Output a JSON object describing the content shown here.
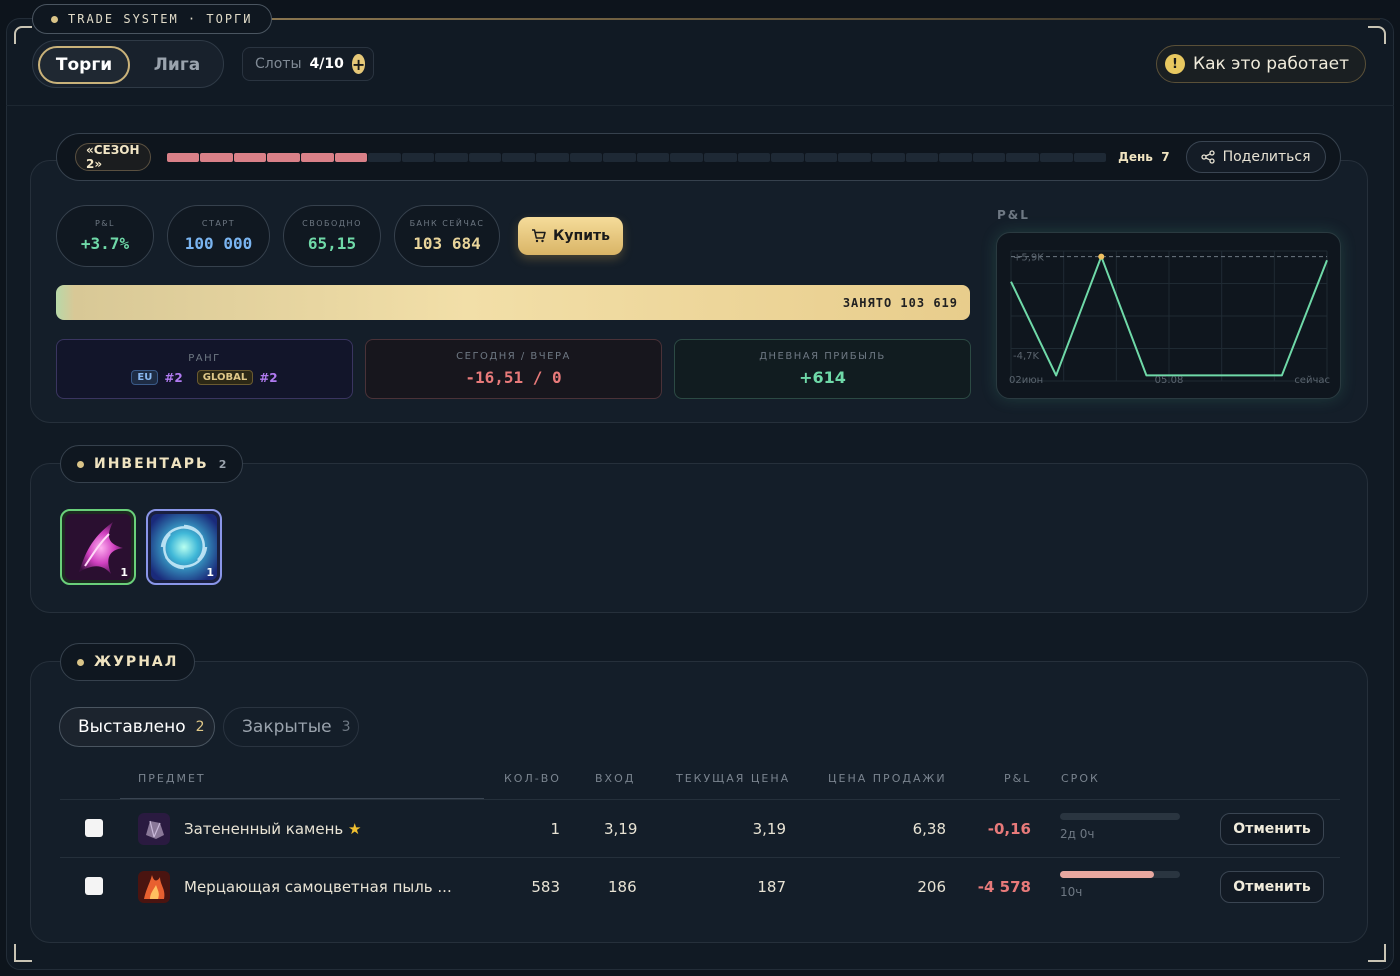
{
  "app": {
    "title": "TRADE SYSTEM · ТОРГИ"
  },
  "header": {
    "tabs": [
      "Торги",
      "Лига"
    ],
    "slots_label": "Слоты",
    "slots_value": "4/10",
    "how_label": "Как это работает"
  },
  "season": {
    "label": "«СЕЗОН 2»",
    "progress": {
      "filled": 6,
      "total": 28
    },
    "day_label": "День",
    "day_value": "7",
    "share_label": "Поделиться"
  },
  "stats": {
    "pnl": {
      "label": "P&L",
      "value": "+3.7%"
    },
    "start": {
      "label": "СТАРТ",
      "value": "100 000"
    },
    "free": {
      "label": "СВОБОДНО",
      "value": "65,15"
    },
    "bank": {
      "label": "БАНК СЕЙЧАС",
      "value": "103 684"
    },
    "buy_label": "Купить",
    "busy_label": "ЗАНЯТО",
    "busy_value": "103 619"
  },
  "cards": {
    "rank": {
      "label": "РАНГ",
      "eu_tag": "EU",
      "eu_rank": "#2",
      "global_tag": "GLOBAL",
      "global_rank": "#2"
    },
    "today": {
      "label": "СЕГОДНЯ / ВЧЕРА",
      "value": "-16,51 / 0"
    },
    "daily": {
      "label": "ДНЕВНАЯ ПРИБЫЛЬ",
      "value": "+614"
    }
  },
  "chart_data": {
    "type": "line",
    "title": "P&L",
    "y_tick_labels": [
      "+5,9K",
      "-4,7K"
    ],
    "x_tick_labels": [
      "02июн",
      "05.08",
      "сейчас"
    ],
    "values": [
      3.2,
      -6.9,
      5.9,
      -6.9,
      -6.9,
      -6.9,
      -6.9,
      5.5
    ],
    "ylim": [
      -7.5,
      6.5
    ],
    "reference_line": 5.9,
    "highlight_index": 2,
    "color": "#6fd9a8"
  },
  "inventory": {
    "title": "ИНВЕНТАРЬ",
    "count": "2",
    "items": [
      {
        "name": "pink-claw-icon",
        "count": "1"
      },
      {
        "name": "blue-vortex-icon",
        "count": "1"
      }
    ]
  },
  "journal": {
    "title": "ЖУРНАЛ",
    "tabs": [
      {
        "label": "Выставлено",
        "count": "2"
      },
      {
        "label": "Закрытые",
        "count": "3"
      }
    ],
    "columns": [
      "ПРЕДМЕТ",
      "КОЛ-ВО",
      "ВХОД",
      "ТЕКУЩАЯ ЦЕНА",
      "ЦЕНА ПРОДАЖИ",
      "P&L",
      "СРОК"
    ],
    "rows": [
      {
        "item": "Затененный камень",
        "qty": "1",
        "entry": "3,19",
        "current": "3,19",
        "sell": "6,38",
        "pnl": "-0,16",
        "term": "2д 0ч",
        "term_progress": 0.0,
        "cancel": "Отменить"
      },
      {
        "item": "Мерцающая самоцветная пыль ...",
        "qty": "583",
        "entry": "186",
        "current": "187",
        "sell": "206",
        "pnl": "-4 578",
        "term": "10ч",
        "term_progress": 0.78,
        "cancel": "Отменить"
      }
    ]
  },
  "colors": {
    "accent": "#d9c488",
    "positive": "#6fd9a8",
    "negative": "#e87a7a",
    "blue": "#7ab4f0"
  }
}
